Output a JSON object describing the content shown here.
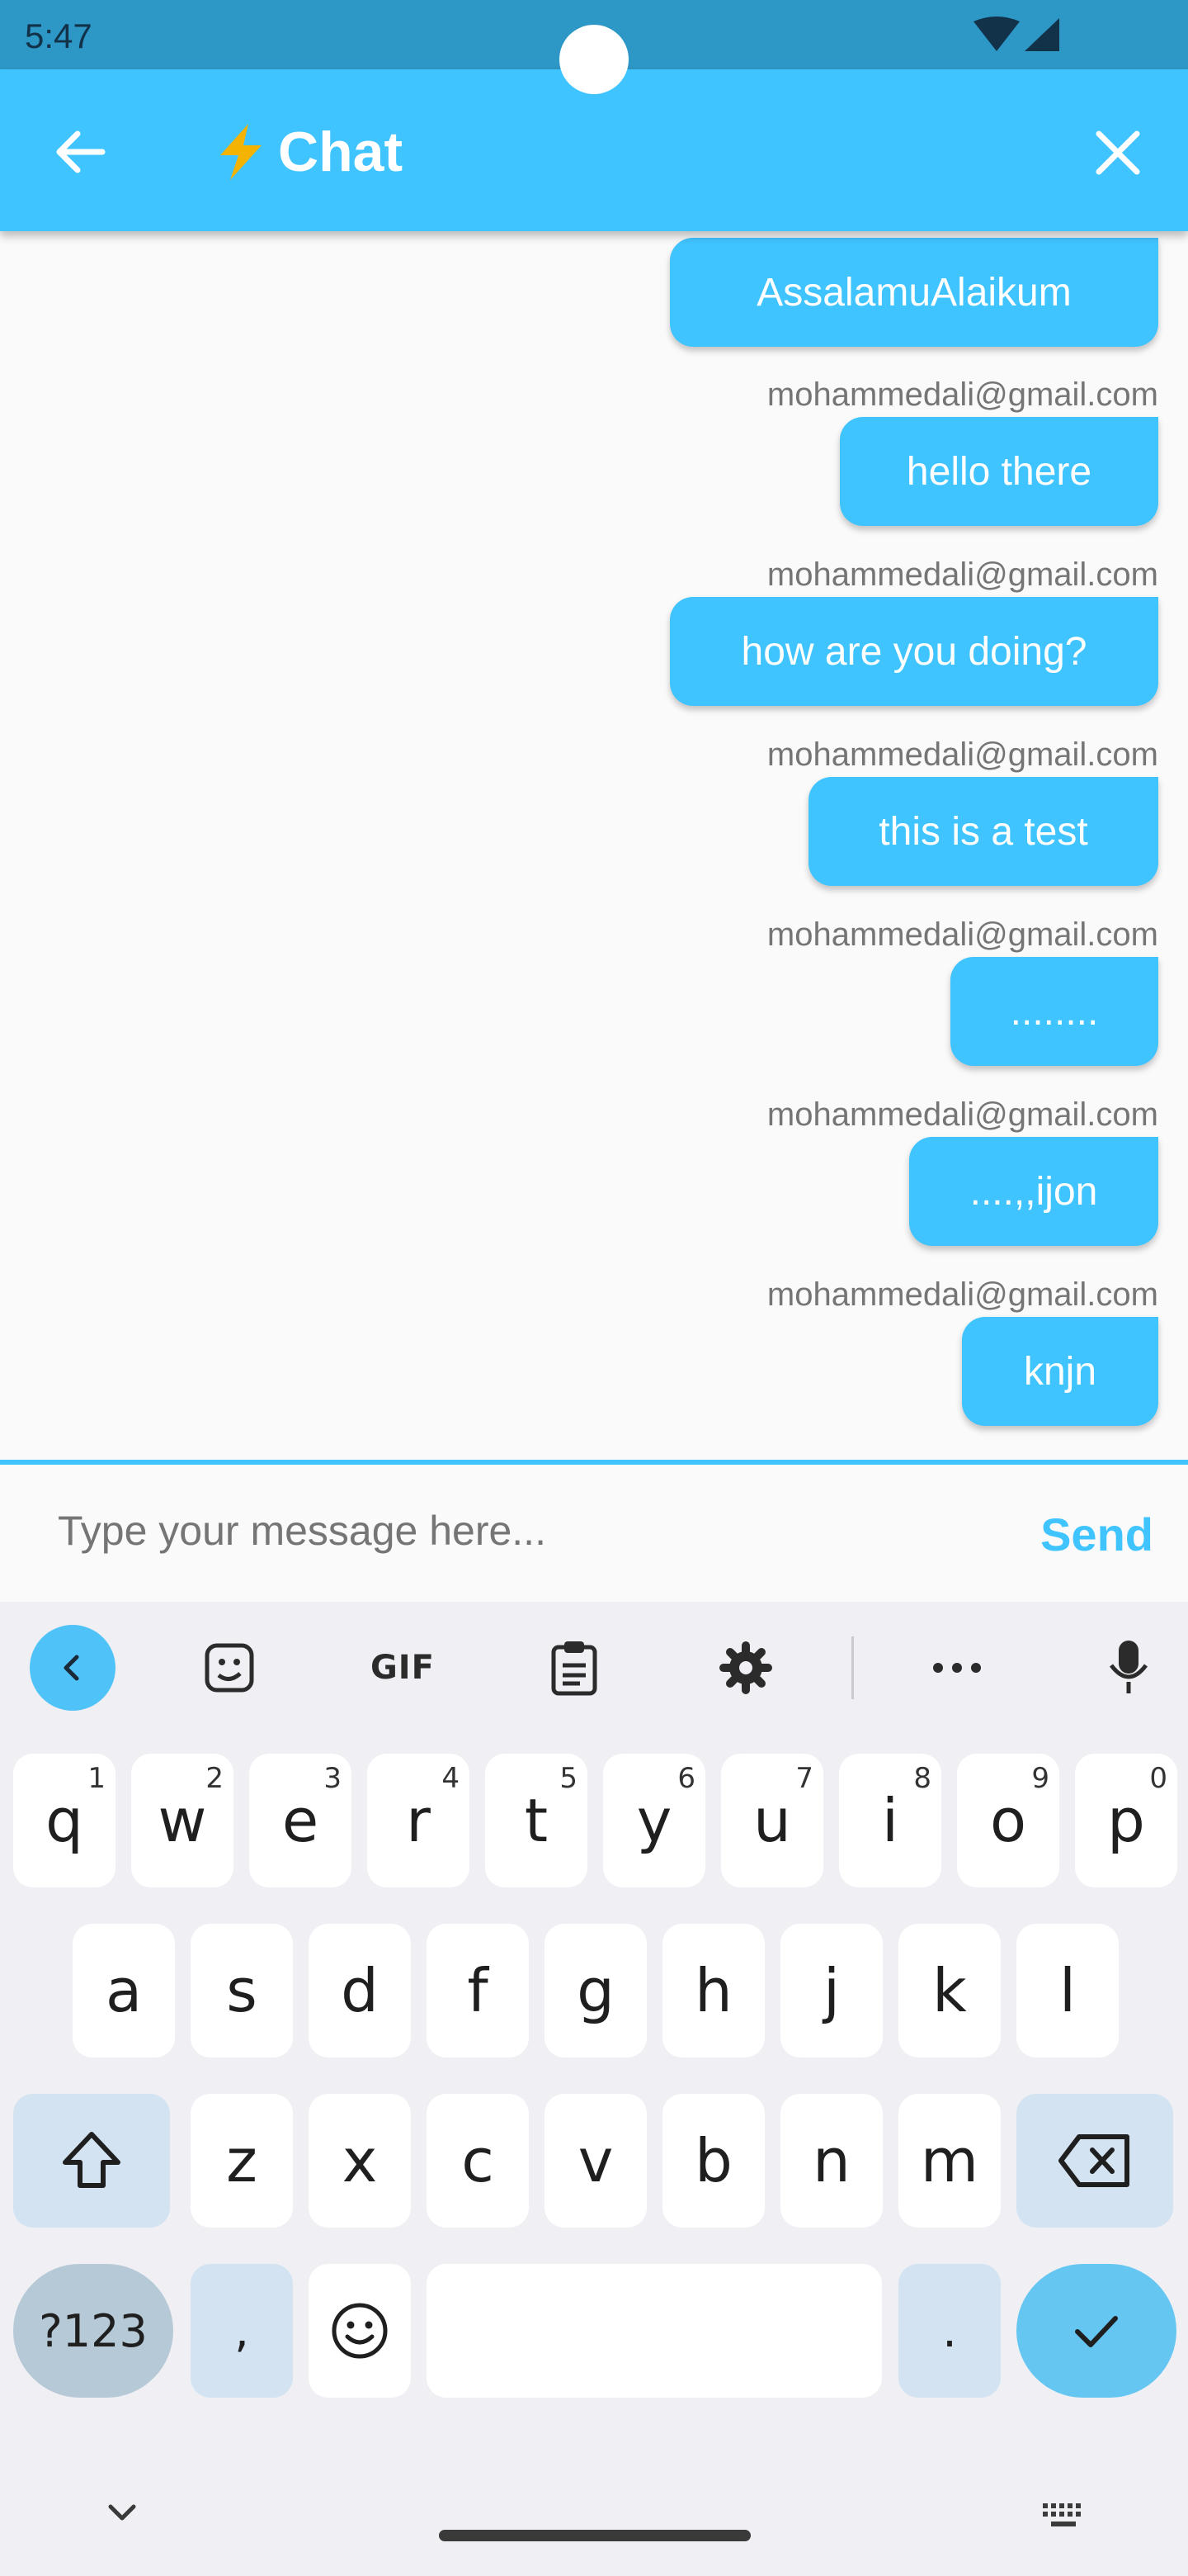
{
  "status_bar": {
    "time": "5:47"
  },
  "app_bar": {
    "title": "Chat",
    "back_icon": "arrow-left-icon",
    "close_icon": "close-icon",
    "title_icon": "lightning-bolt-icon"
  },
  "messages": [
    {
      "sender": "",
      "text": "AssalamuAlaikum"
    },
    {
      "sender": "mohammedali@gmail.com",
      "text": "hello there"
    },
    {
      "sender": "mohammedali@gmail.com",
      "text": "how are you doing?"
    },
    {
      "sender": "mohammedali@gmail.com",
      "text": "this is a test"
    },
    {
      "sender": "mohammedali@gmail.com",
      "text": "........"
    },
    {
      "sender": "mohammedali@gmail.com",
      "text": "....,,ijon"
    },
    {
      "sender": "mohammedali@gmail.com",
      "text": "knjn"
    }
  ],
  "composer": {
    "placeholder": "Type your message here...",
    "value": "",
    "send_label": "Send"
  },
  "keyboard": {
    "toolbar": [
      "collapse-icon",
      "sticker-icon",
      "GIF",
      "clipboard-icon",
      "settings-icon",
      "more-icon",
      "microphone-icon"
    ],
    "gif_label": "GIF",
    "row1": [
      {
        "k": "q",
        "h": "1"
      },
      {
        "k": "w",
        "h": "2"
      },
      {
        "k": "e",
        "h": "3"
      },
      {
        "k": "r",
        "h": "4"
      },
      {
        "k": "t",
        "h": "5"
      },
      {
        "k": "y",
        "h": "6"
      },
      {
        "k": "u",
        "h": "7"
      },
      {
        "k": "i",
        "h": "8"
      },
      {
        "k": "o",
        "h": "9"
      },
      {
        "k": "p",
        "h": "0"
      }
    ],
    "row2": [
      "a",
      "s",
      "d",
      "f",
      "g",
      "h",
      "j",
      "k",
      "l"
    ],
    "row3": [
      "z",
      "x",
      "c",
      "v",
      "b",
      "n",
      "m"
    ],
    "symbols_label": "?123",
    "comma": ",",
    "period": "."
  }
}
